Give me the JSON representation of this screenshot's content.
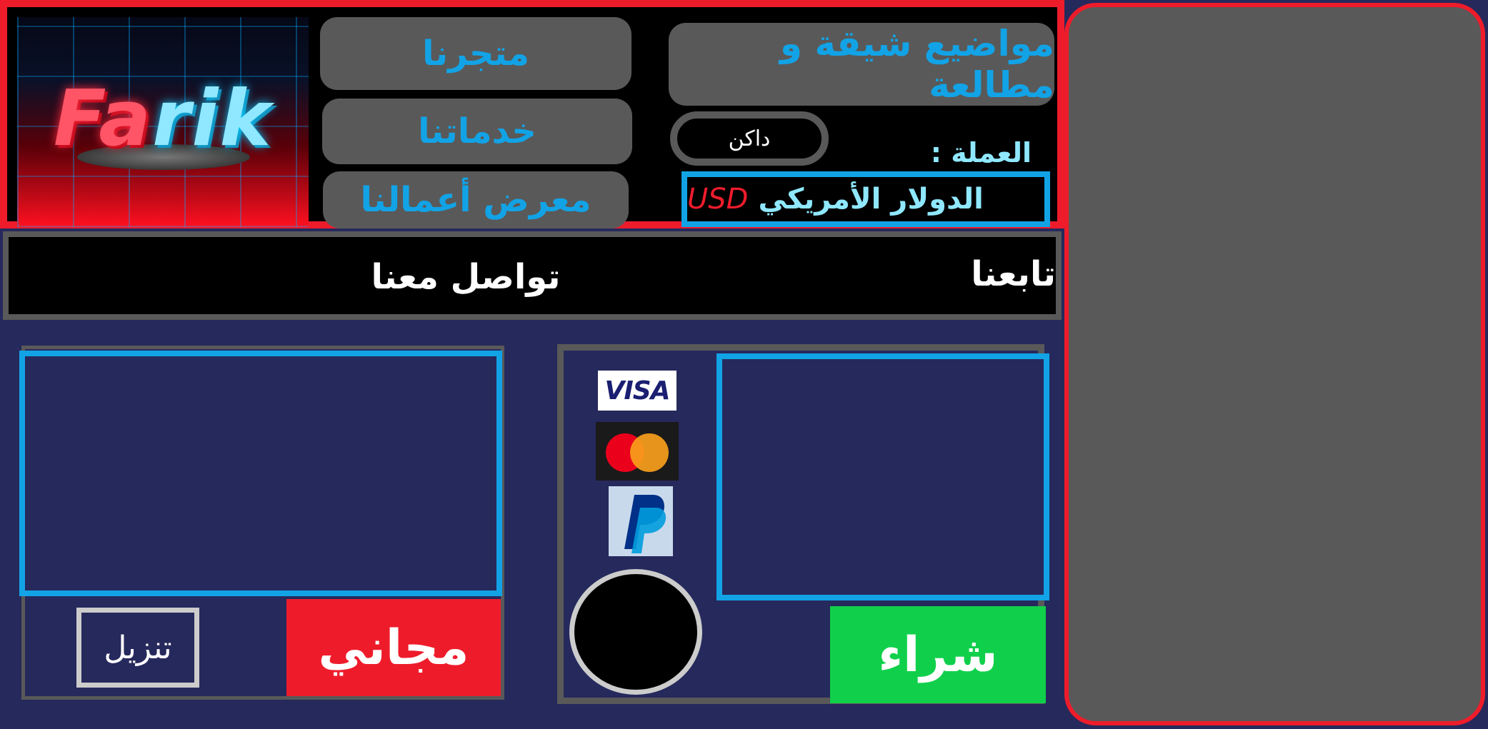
{
  "header": {
    "logo": {
      "text_part1": "Fa",
      "text_part2": "rik"
    },
    "nav": {
      "store": "متجرنا",
      "services": "خدماتنا",
      "gallery": "معرض أعمالنا"
    },
    "topics_button": "مواضيع شيقة و مطالعة",
    "theme_toggle": "داكن",
    "currency": {
      "label": "العملة :",
      "name": "الدولار الأمريكي",
      "code": "USD"
    }
  },
  "contact_bar": {
    "contact": "تواصل معنا",
    "follow": "تابعنا"
  },
  "free_card": {
    "free_label": "مجاني",
    "download_label": "تنزيل"
  },
  "paid_card": {
    "buy_label": "شراء",
    "payment_methods": [
      "visa",
      "mastercard",
      "paypal"
    ],
    "visa_text": "VISA"
  },
  "colors": {
    "accent_blue": "#12a3e6",
    "brand_red": "#ee1c2b",
    "buy_green": "#10d04b",
    "background": "#26295c",
    "panel_gray": "#595959"
  }
}
